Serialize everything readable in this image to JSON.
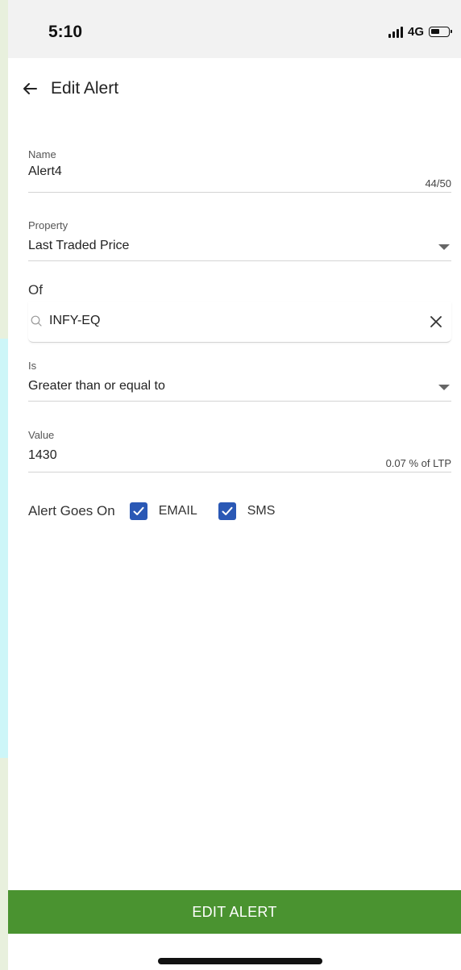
{
  "status_bar": {
    "time": "5:10",
    "network": "4G"
  },
  "header": {
    "title": "Edit Alert"
  },
  "form": {
    "name": {
      "label": "Name",
      "value": "Alert4",
      "counter": "44/50"
    },
    "property": {
      "label": "Property",
      "value": "Last Traded Price"
    },
    "of": {
      "label": "Of",
      "value": "INFY-EQ"
    },
    "is": {
      "label": "Is",
      "value": "Greater than or equal to"
    },
    "value": {
      "label": "Value",
      "value": "1430",
      "helper": "0.07 % of LTP"
    },
    "alert_goes_on": {
      "label": "Alert Goes On",
      "options": [
        {
          "label": "EMAIL",
          "checked": true
        },
        {
          "label": "SMS",
          "checked": true
        }
      ]
    }
  },
  "actions": {
    "submit_label": "EDIT ALERT"
  },
  "colors": {
    "primary_button": "#4a9330",
    "checkbox": "#2a58b5"
  }
}
